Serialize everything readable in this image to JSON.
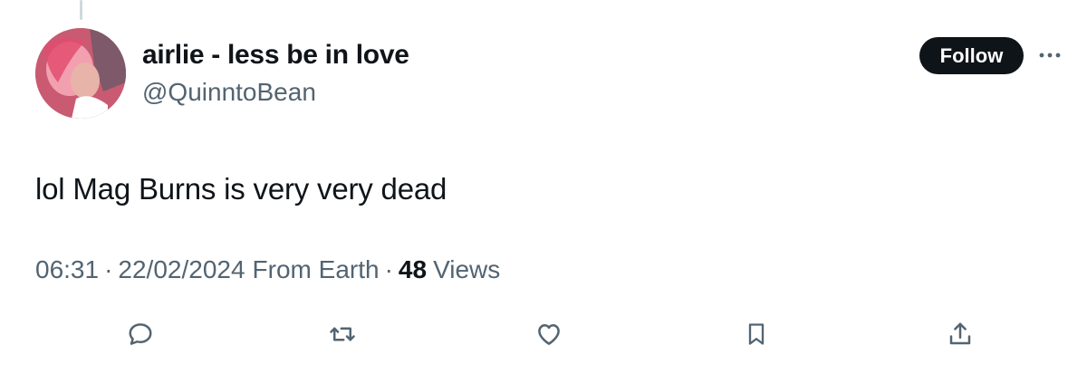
{
  "tweet": {
    "display_name": "airlie - less be in love",
    "handle": "@QuinntoBean",
    "text": "lol Mag Burns is very very dead",
    "time": "06:31",
    "date": "22/02/2024",
    "source": "From Earth",
    "separator": "·",
    "views_count": "48",
    "views_label": "Views"
  },
  "header": {
    "follow_label": "Follow",
    "more_icon": "more-horizontal-icon"
  },
  "actions": [
    {
      "icon": "reply-icon"
    },
    {
      "icon": "retweet-icon"
    },
    {
      "icon": "like-icon"
    },
    {
      "icon": "bookmark-icon"
    },
    {
      "icon": "share-icon"
    }
  ],
  "colors": {
    "text_primary": "#0f1419",
    "text_secondary": "#536471",
    "follow_bg": "#0f1419",
    "follow_text": "#ffffff",
    "icon": "#536471",
    "thread_line": "#cfd9de"
  }
}
